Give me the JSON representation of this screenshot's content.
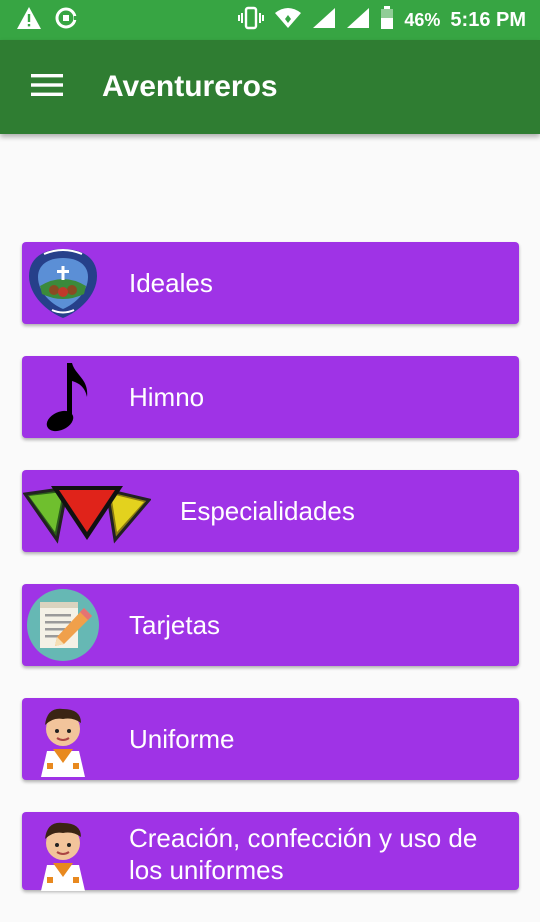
{
  "status_bar": {
    "battery": "46%",
    "time": "5:16 PM",
    "icons": [
      "warning-icon",
      "sync-icon",
      "vibrate-icon",
      "wifi-icon",
      "signal-icon",
      "signal-icon",
      "battery-icon"
    ]
  },
  "app_bar": {
    "title": "Aventureros",
    "menu_icon": "hamburger-menu-icon"
  },
  "menu": {
    "items": [
      {
        "label": "Ideales",
        "icon": "adventurer-club-badge-icon"
      },
      {
        "label": "Himno",
        "icon": "music-note-icon"
      },
      {
        "label": "Especialidades",
        "icon": "triangle-badges-icon"
      },
      {
        "label": "Tarjetas",
        "icon": "notepad-pencil-icon"
      },
      {
        "label": "Uniforme",
        "icon": "boy-uniform-icon"
      },
      {
        "label": "Creación, confección y uso de los uniformes",
        "icon": "boy-uniform-icon"
      }
    ]
  },
  "colors": {
    "status_bar": "#37a543",
    "app_bar": "#2f7d32",
    "item_background": "#9f33e6",
    "page_background": "#fafafa"
  }
}
